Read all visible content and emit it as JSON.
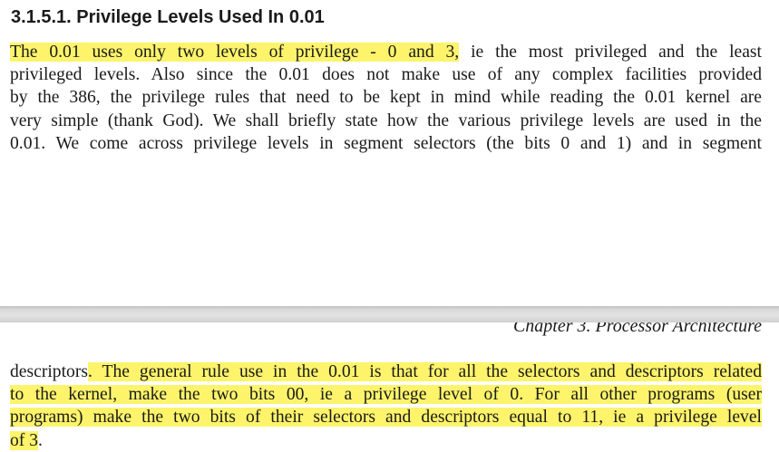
{
  "section": {
    "heading": "3.1.5.1. Privilege Levels Used In 0.01"
  },
  "top_page": {
    "lines": [
      {
        "highlight": "The 0.01 uses only two levels of privilege - 0 and 3,",
        "rest": " ie the most privileged and the least"
      },
      {
        "text": "privileged levels. Also since the 0.01 does not make use of any complex facilities provided"
      },
      {
        "text": "by the 386, the privilege rules that need to be kept in mind while reading the 0.01 kernel are"
      },
      {
        "text": "very simple (thank God). We shall briefly state how the various privilege levels are used in the"
      },
      {
        "text": "0.01. We come across privilege levels in segment selectors (the bits 0 and 1) and in segment"
      }
    ]
  },
  "bottom_page": {
    "running_header": "Chapter 3. Processor Architecture",
    "lines": [
      {
        "lead": "descriptors",
        "highlight": ". The general rule use in the 0.01 is that for all the selectors and descriptors related"
      },
      {
        "highlight": "to the kernel, make the two bits 00, ie a privilege level of 0. For all other programs (user"
      },
      {
        "highlight": "programs) make the two bits of their selectors and descriptors equal to 11, ie a privilege level"
      },
      {
        "highlight": "of 3",
        "tail": "."
      }
    ]
  },
  "colors": {
    "highlight": "#fdf46b",
    "page_gap": "#d7d7d7",
    "text": "#1a1a1a"
  }
}
